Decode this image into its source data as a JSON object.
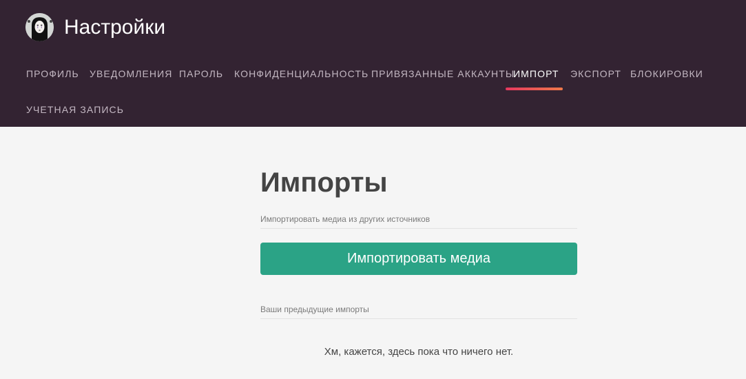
{
  "header": {
    "title": "Настройки",
    "avatar_icon": "no-face-avatar-icon"
  },
  "nav": {
    "items": [
      {
        "label": "ПРОФИЛЬ",
        "active": false
      },
      {
        "label": "УВЕДОМЛЕНИЯ",
        "active": false
      },
      {
        "label": "ПАРОЛЬ",
        "active": false
      },
      {
        "label": "КОНФИДЕНЦИАЛЬНОСТЬ",
        "active": false
      },
      {
        "label": "ПРИВЯЗАННЫЕ АККАУНТЫ",
        "active": false
      },
      {
        "label": "ИМПОРТ",
        "active": true
      },
      {
        "label": "ЭКСПОРТ",
        "active": false
      },
      {
        "label": "БЛОКИРОВКИ",
        "active": false
      },
      {
        "label": "УЧЕТНАЯ ЗАПИСЬ",
        "active": false
      }
    ]
  },
  "main": {
    "title": "Импорты",
    "import_section_label": "Импортировать медиа из других источников",
    "import_button_label": "Импортировать медиа",
    "previous_section_label": "Ваши предыдущие импорты",
    "empty_message": "Хм, кажется, здесь пока что ничего нет."
  },
  "colors": {
    "header_bg": "#332332",
    "accent_green": "#2ba386",
    "active_tab_gradient_start": "#e6385f",
    "active_tab_gradient_end": "#f07a4a"
  }
}
